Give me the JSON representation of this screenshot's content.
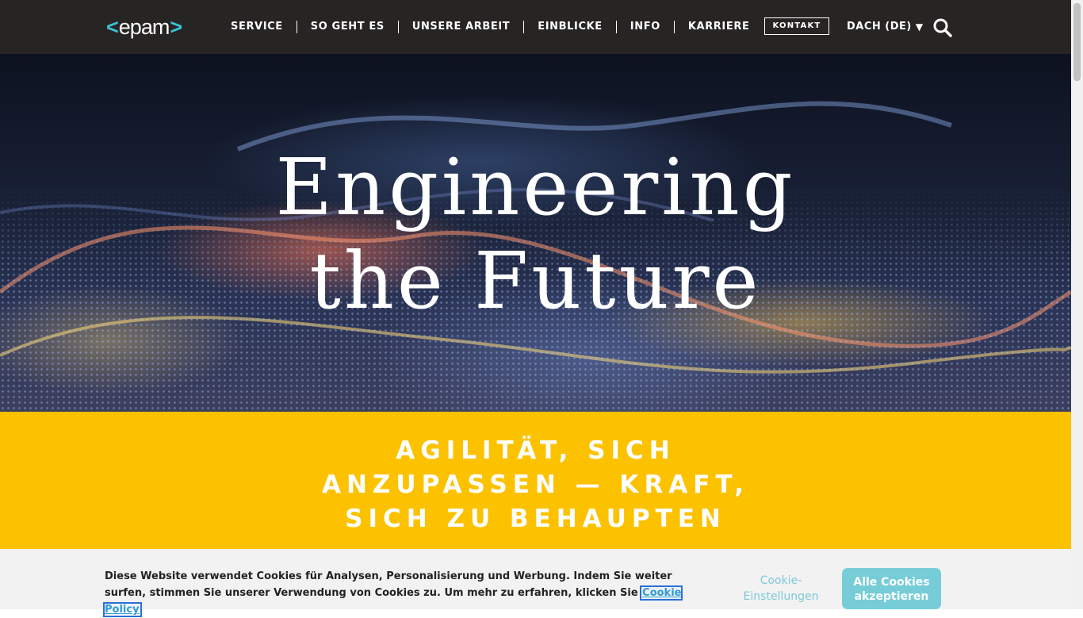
{
  "header": {
    "logo": {
      "left_bracket": "<",
      "text": "epam",
      "right_bracket": ">"
    },
    "nav": [
      {
        "label": "SERVICE"
      },
      {
        "label": "SO GEHT ES"
      },
      {
        "label": "UNSERE ARBEIT"
      },
      {
        "label": "EINBLICKE"
      },
      {
        "label": "INFO"
      },
      {
        "label": "KARRIERE"
      }
    ],
    "contact_label": "KONTAKT",
    "region_label": "DACH (DE)",
    "region_icon": "triangle-down-icon",
    "search_icon": "search-icon"
  },
  "hero": {
    "title_line1": "Engineering",
    "title_line2": "the Future"
  },
  "band": {
    "lines": [
      "AGILITÄT, SICH",
      "ANZUPASSEN — KRAFT,",
      "SICH ZU BEHAUPTEN"
    ]
  },
  "cookie": {
    "text": "Diese Website verwendet Cookies für Analysen, Personalisierung und Werbung. Indem Sie weiter surfen, stimmen Sie unserer Verwendung von Cookies zu. Um mehr zu erfahren, klicken Sie ",
    "link_label": "Cookie Policy",
    "settings_label": "Cookie-Einstellungen",
    "accept_label": "Alle Cookies akzeptieren"
  },
  "colors": {
    "header_bg": "#272424",
    "brand_accent": "#39c2d7",
    "band_yellow": "#fcc200",
    "accept_button": "#76cdd8"
  }
}
